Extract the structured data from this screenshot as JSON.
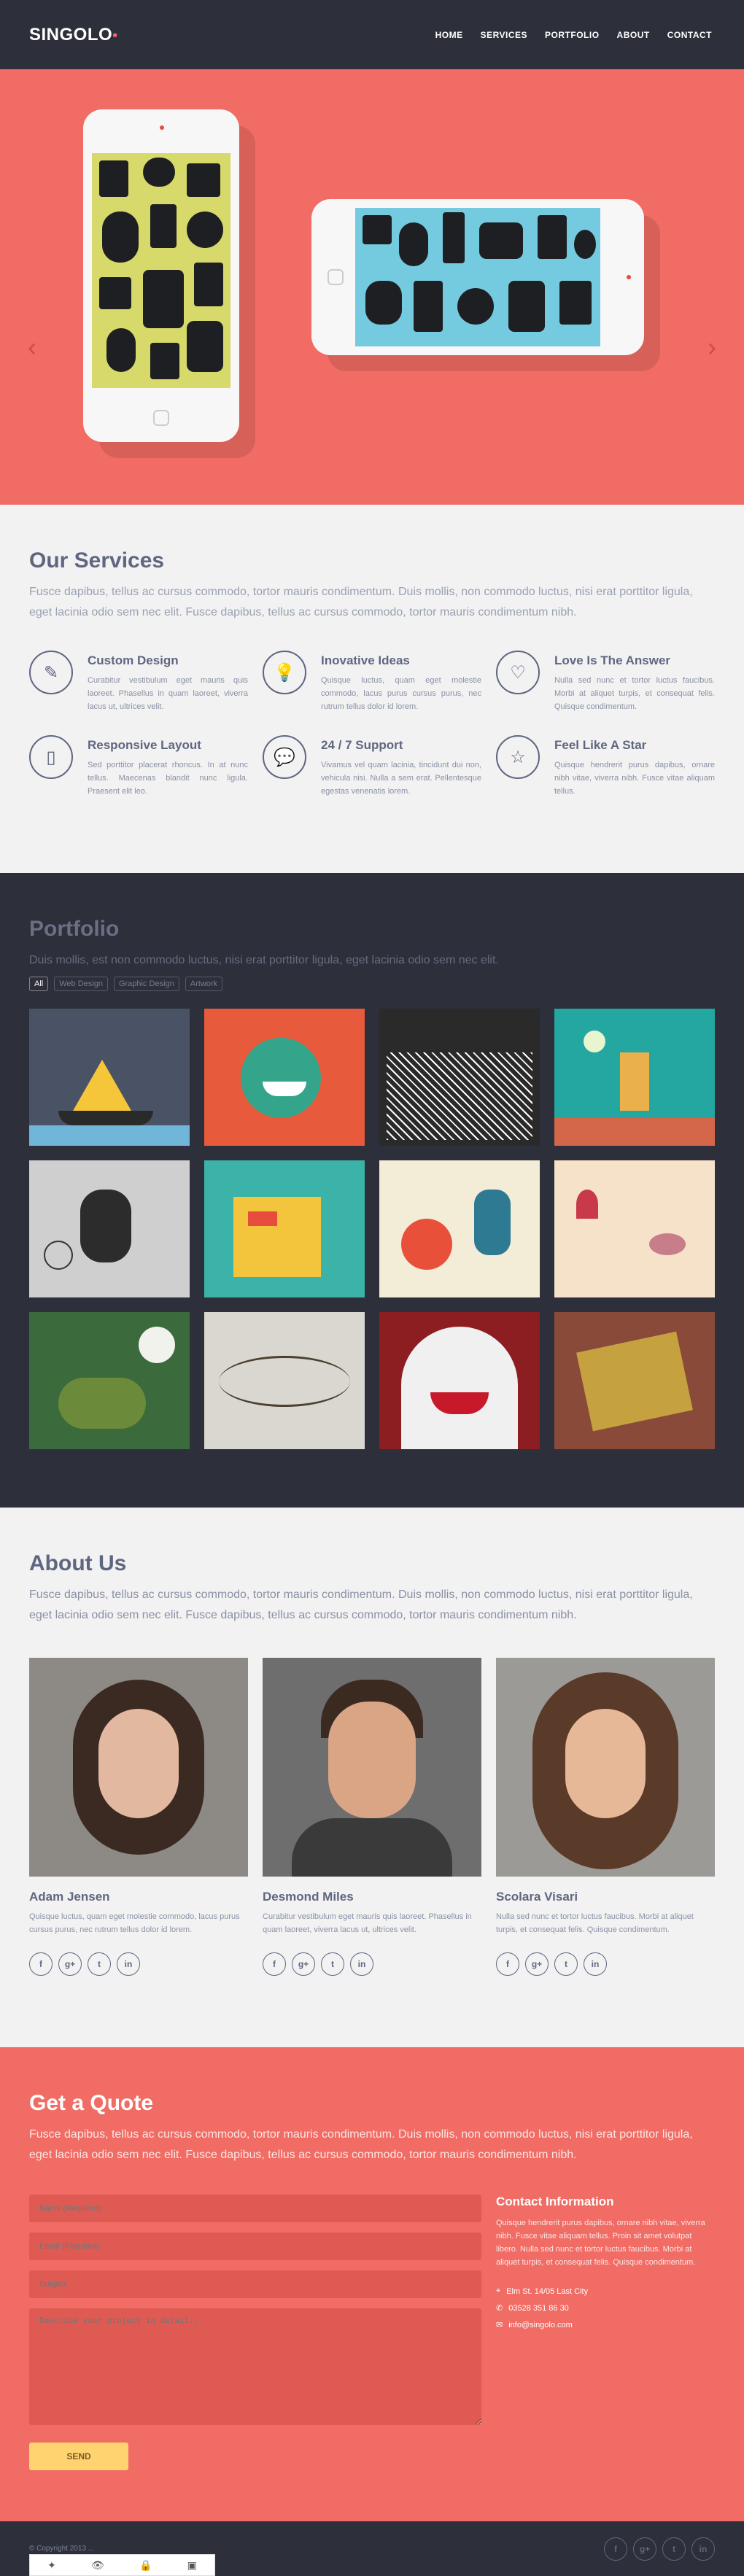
{
  "header": {
    "logo": "SINGOLO",
    "logo_mark": "•",
    "nav": [
      "HOME",
      "SERVICES",
      "PORTFOLIO",
      "ABOUT",
      "CONTACT"
    ]
  },
  "slider": {
    "prev": "‹",
    "next": "›"
  },
  "services": {
    "title": "Our Services",
    "intro": "Fusce dapibus, tellus ac cursus commodo, tortor mauris condimentum. Duis mollis, non commodo luctus, nisi erat porttitor ligula, eget lacinia odio sem nec elit. Fusce dapibus, tellus ac cursus commodo, tortor mauris condimentum nibh.",
    "items": [
      {
        "title": "Custom Design",
        "icon": "pencil-icon",
        "glyph": "✎",
        "text": "Curabitur vestibulum eget mauris quis laoreet. Phasellus in quam laoreet, viverra lacus ut, ultrices velit."
      },
      {
        "title": "Inovative Ideas",
        "icon": "bulb-icon",
        "glyph": "💡",
        "text": "Quisque luctus, quam eget molestie commodo, lacus purus cursus purus, nec rutrum tellus dolor id lorem."
      },
      {
        "title": "Love Is The Answer",
        "icon": "heart-icon",
        "glyph": "♡",
        "text": "Nulla sed nunc et tortor luctus faucibus. Morbi at aliquet turpis, et consequat felis. Quisque condimentum."
      },
      {
        "title": "Responsive Layout",
        "icon": "phone-icon",
        "glyph": "▯",
        "text": "Sed porttitor placerat rhoncus. In at nunc tellus. Maecenas blandit nunc ligula. Praesent elit leo."
      },
      {
        "title": "24 / 7 Support",
        "icon": "chat-icon",
        "glyph": "💬",
        "text": "Vivamus vel quam lacinia, tincidunt dui non, vehicula nisi. Nulla a sem erat. Pellentesque egestas venenatis lorem."
      },
      {
        "title": "Feel Like A Star",
        "icon": "star-icon",
        "glyph": "☆",
        "text": "Quisque hendrerit purus dapibus, ornare nibh vitae, viverra nibh. Fusce vitae aliquam tellus."
      }
    ]
  },
  "portfolio": {
    "title": "Portfolio",
    "intro": "Duis mollis, est non commodo luctus, nisi erat porttitor ligula, eget lacinia odio sem nec elit.",
    "filters": [
      "All",
      "Web Design",
      "Graphic Design",
      "Artwork"
    ],
    "items": [
      {
        "name": "sailboat-artwork",
        "color": "#4a5365"
      },
      {
        "name": "green-monster-artwork",
        "color": "#e85a3c"
      },
      {
        "name": "doodle-city-artwork",
        "color": "#2a2a2a"
      },
      {
        "name": "robot-island-artwork",
        "color": "#23a7a0"
      },
      {
        "name": "sketch-creatures-artwork",
        "color": "#cfcfcf"
      },
      {
        "name": "sdk-city-artwork",
        "color": "#3bb3a9"
      },
      {
        "name": "red-robots-artwork",
        "color": "#f3ecd7"
      },
      {
        "name": "birds-artwork",
        "color": "#f6e2c9"
      },
      {
        "name": "dragon-artwork",
        "color": "#3b6a3d"
      },
      {
        "name": "lettering-artwork",
        "color": "#d9d7cf"
      },
      {
        "name": "white-monster-artwork",
        "color": "#8c1e22"
      },
      {
        "name": "golden-book-artwork",
        "color": "#8a4a3a"
      }
    ]
  },
  "about": {
    "title": "About Us",
    "intro": "Fusce dapibus, tellus ac cursus commodo, tortor mauris condimentum. Duis mollis, non commodo luctus, nisi erat porttitor ligula, eget lacinia odio sem nec elit. Fusce dapibus, tellus ac cursus commodo, tortor mauris condimentum nibh.",
    "members": [
      {
        "name": "Adam Jensen",
        "text": "Quisque luctus, quam eget molestie commodo, lacus purus cursus purus, nec rutrum tellus dolor id lorem."
      },
      {
        "name": "Desmond Miles",
        "text": "Curabitur vestibulum eget mauris quis laoreet. Phasellus in quam laoreet, viverra lacus ut, ultrices velit."
      },
      {
        "name": "Scolara Visari",
        "text": "Nulla sed nunc et tortor luctus faucibus. Morbi at aliquet turpis, et consequat felis. Quisque condimentum."
      }
    ],
    "social": [
      "f",
      "g+",
      "t",
      "in"
    ]
  },
  "quote": {
    "title": "Get a Quote",
    "intro": "Fusce dapibus, tellus ac cursus commodo, tortor mauris condimentum. Duis mollis, non commodo luctus, nisi erat porttitor ligula, eget lacinia odio sem nec elit. Fusce dapibus, tellus ac cursus commodo, tortor mauris condimentum nibh.",
    "fields": {
      "name": "Name (Required)",
      "email": "Email (Required)",
      "subject": "Subject",
      "details": "Describe your project in detail..."
    },
    "send": "SEND",
    "contact": {
      "title": "Contact Information",
      "text": "Quisque hendrerit purus dapibus, ornare nibh vitae, viverra nibh. Fusce vitae aliquam tellus. Proin sit amet volutpat libero. Nulla sed nunc et tortor luctus faucibus. Morbi at aliquet turpis, et consequat felis. Quisque condimentum.",
      "address": "Elm St. 14/05 Last City",
      "phone": "03528 351 86 30",
      "email": "info@singolo.com"
    }
  },
  "footer": {
    "copyright": "© Copyright 2013 ...",
    "social": [
      "f",
      "g+",
      "t",
      "in"
    ],
    "toolbar": [
      "✦",
      "👁",
      "🔒",
      "▣"
    ]
  },
  "colors": {
    "accent": "#f06c64",
    "dark": "#2d303a",
    "light": "#f2f2f2",
    "heading": "#5f6680",
    "button": "#ffd36f"
  }
}
